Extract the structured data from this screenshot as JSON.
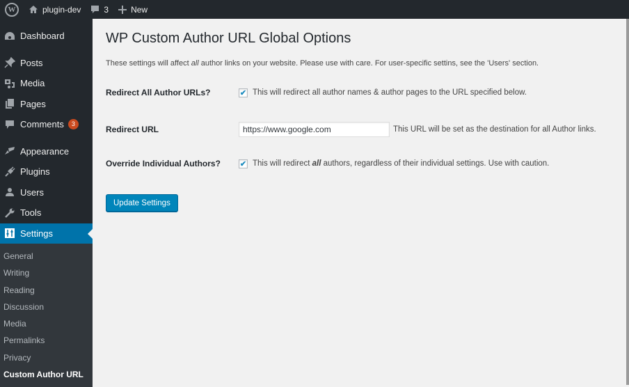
{
  "adminbar": {
    "logo_icon": "wordpress-logo-icon",
    "site_name": "plugin-dev",
    "site_icon": "home-icon",
    "comments_count": "3",
    "comments_icon": "comment-bubble-icon",
    "new_label": "New",
    "new_icon": "plus-icon"
  },
  "sidebar": {
    "items": [
      {
        "label": "Dashboard",
        "icon": "dashboard-icon"
      },
      {
        "label": "Posts",
        "icon": "pin-icon"
      },
      {
        "label": "Media",
        "icon": "media-icon"
      },
      {
        "label": "Pages",
        "icon": "pages-icon"
      },
      {
        "label": "Comments",
        "icon": "comment-icon",
        "badge": "3"
      },
      {
        "label": "Appearance",
        "icon": "paintbrush-icon"
      },
      {
        "label": "Plugins",
        "icon": "plugin-icon"
      },
      {
        "label": "Users",
        "icon": "user-icon"
      },
      {
        "label": "Tools",
        "icon": "wrench-icon"
      },
      {
        "label": "Settings",
        "icon": "settings-sliders-icon",
        "current": true
      }
    ],
    "submenu": [
      "General",
      "Writing",
      "Reading",
      "Discussion",
      "Media",
      "Permalinks",
      "Privacy",
      "Custom Author URL"
    ],
    "submenu_current": "Custom Author URL"
  },
  "main": {
    "title": "WP Custom Author URL Global Options",
    "intro_before": "These settings will affect ",
    "intro_em": "all",
    "intro_after": " author links on your website. Please use with care. For user-specific settins, see the 'Users' section.",
    "fields": {
      "redirect_all": {
        "label": "Redirect All Author URLs?",
        "checked": true,
        "description": "This will redirect all author names & author pages to the URL specified below."
      },
      "redirect_url": {
        "label": "Redirect URL",
        "value": "https://www.google.com",
        "description": "This URL will be set as the destination for all Author links."
      },
      "override": {
        "label": "Override Individual Authors?",
        "checked": true,
        "desc_before": "This will redirect ",
        "desc_em": "all",
        "desc_after": " authors, regardless of their individual settings. Use with caution."
      }
    },
    "submit_label": "Update Settings"
  },
  "colors": {
    "adminbar_bg": "#23282d",
    "accent": "#0073aa",
    "button": "#0085ba",
    "badge": "#ca4a1f"
  }
}
